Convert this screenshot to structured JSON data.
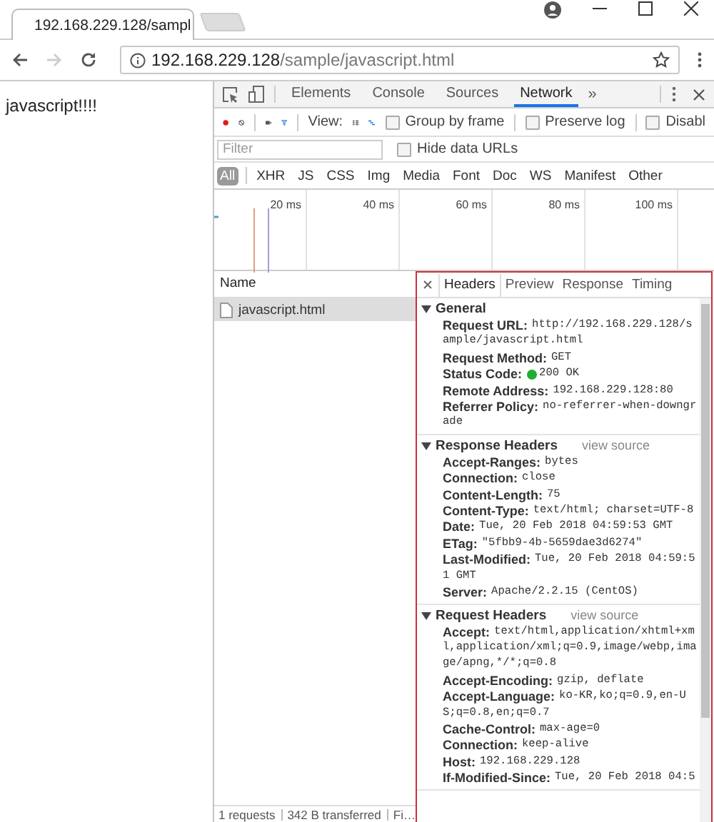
{
  "browser_tab": {
    "title": "192.168.229.128/sampl"
  },
  "address_bar": {
    "host": "192.168.229.128",
    "path": "/sample/javascript.html"
  },
  "page": {
    "text": "javascript!!!!"
  },
  "devtools": {
    "tabs": [
      {
        "label": "Elements",
        "selected": false
      },
      {
        "label": "Console",
        "selected": false
      },
      {
        "label": "Sources",
        "selected": false
      },
      {
        "label": "Network",
        "selected": true
      }
    ],
    "overflow": "»"
  },
  "network_toolbar": {
    "recording": true,
    "view_label": "View:",
    "options": [
      {
        "label": "Group by frame",
        "checked": false
      },
      {
        "label": "Preserve log",
        "checked": false
      },
      {
        "label": "Disabl",
        "checked": false
      }
    ]
  },
  "filter_bar": {
    "placeholder": "Filter",
    "hide_data_urls": {
      "label": "Hide data URLs",
      "checked": false
    }
  },
  "type_filters": [
    {
      "label": "All",
      "selected": true
    },
    {
      "label": "XHR",
      "selected": false
    },
    {
      "label": "JS",
      "selected": false
    },
    {
      "label": "CSS",
      "selected": false
    },
    {
      "label": "Img",
      "selected": false
    },
    {
      "label": "Media",
      "selected": false
    },
    {
      "label": "Font",
      "selected": false
    },
    {
      "label": "Doc",
      "selected": false
    },
    {
      "label": "WS",
      "selected": false
    },
    {
      "label": "Manifest",
      "selected": false
    },
    {
      "label": "Other",
      "selected": false
    }
  ],
  "overview": {
    "ticks": [
      "20 ms",
      "40 ms",
      "60 ms",
      "80 ms",
      "100 ms"
    ]
  },
  "requests": {
    "column": "Name",
    "rows": [
      {
        "name": "javascript.html",
        "selected": true
      }
    ]
  },
  "details": {
    "tabs": [
      {
        "label": "Headers",
        "selected": true
      },
      {
        "label": "Preview",
        "selected": false
      },
      {
        "label": "Response",
        "selected": false
      },
      {
        "label": "Timing",
        "selected": false
      }
    ],
    "sections": [
      {
        "title": "General",
        "expanded": true,
        "headers": [
          {
            "kind": "plain",
            "name": "Request URL:",
            "value": "http://192.168.229.128/sample/javascript.html"
          },
          {
            "kind": "plain",
            "name": "Request Method:",
            "value": "GET"
          },
          {
            "kind": "status",
            "name": "Status Code:",
            "value": "200 OK"
          },
          {
            "kind": "plain",
            "name": "Remote Address:",
            "value": "192.168.229.128:80"
          },
          {
            "kind": "plain",
            "name": "Referrer Policy:",
            "value": "no-referrer-when-downgrade"
          }
        ]
      },
      {
        "title": "Response Headers",
        "expanded": true,
        "link": "view source",
        "headers": [
          {
            "kind": "plain",
            "name": "Accept-Ranges:",
            "value": "bytes"
          },
          {
            "kind": "plain",
            "name": "Connection:",
            "value": "close"
          },
          {
            "kind": "plain",
            "name": "Content-Length:",
            "value": "75"
          },
          {
            "kind": "plain",
            "name": "Content-Type:",
            "value": "text/html; charset=UTF-8"
          },
          {
            "kind": "plain",
            "name": "Date:",
            "value": "Tue, 20 Feb 2018 04:59:53 GMT"
          },
          {
            "kind": "plain",
            "name": "ETag:",
            "value": "\"5fbb9-4b-5659dae3d6274\""
          },
          {
            "kind": "plain",
            "name": "Last-Modified:",
            "value": "Tue, 20 Feb 2018 04:59:51 GMT"
          },
          {
            "kind": "plain",
            "name": "Server:",
            "value": "Apache/2.2.15 (CentOS)"
          }
        ]
      },
      {
        "title": "Request Headers",
        "expanded": true,
        "link": "view source",
        "headers": [
          {
            "kind": "plain",
            "name": "Accept:",
            "value": "text/html,application/xhtml+xml,application/xml;q=0.9,image/webp,image/apng,*/*;q=0.8"
          },
          {
            "kind": "plain",
            "name": "Accept-Encoding:",
            "value": "gzip, deflate"
          },
          {
            "kind": "plain",
            "name": "Accept-Language:",
            "value": "ko-KR,ko;q=0.9,en-US;q=0.8,en;q=0.7"
          },
          {
            "kind": "plain",
            "name": "Cache-Control:",
            "value": "max-age=0"
          },
          {
            "kind": "plain",
            "name": "Connection:",
            "value": "keep-alive"
          },
          {
            "kind": "plain",
            "name": "Host:",
            "value": "192.168.229.128"
          },
          {
            "kind": "plain",
            "name": "If-Modified-Since:",
            "value": "Tue, 20 Feb 2018 04:5"
          }
        ]
      }
    ]
  },
  "status_bar": [
    "1 requests",
    "342 B transferred",
    "Fi…"
  ]
}
